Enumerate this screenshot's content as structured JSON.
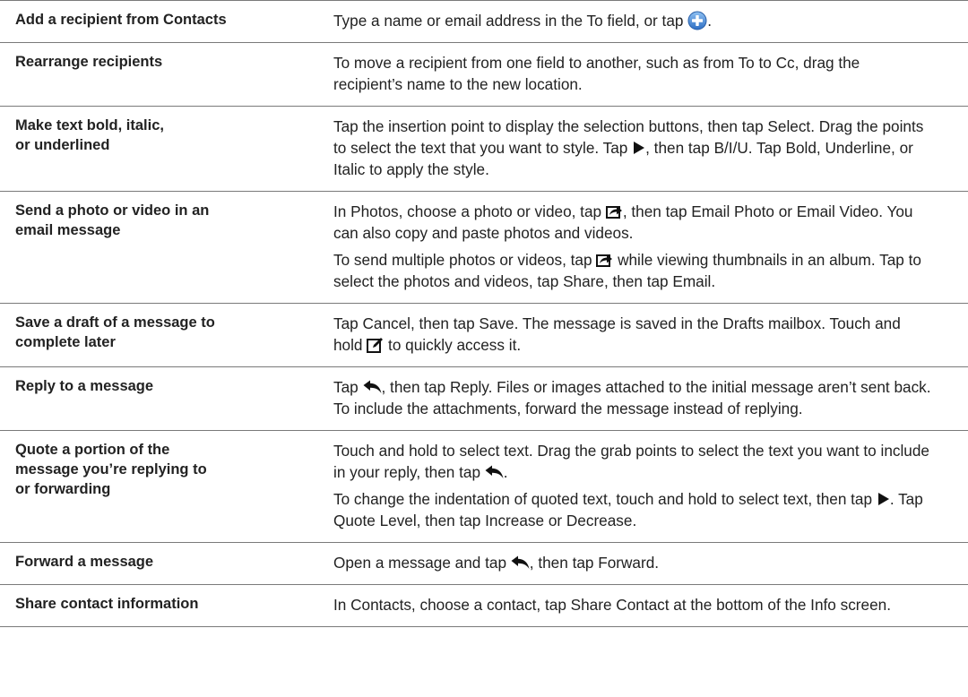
{
  "rows": [
    {
      "task": [
        "Add a recipient from Contacts"
      ],
      "paras": [
        [
          {
            "t": "Type a name or email address in the To field, or tap "
          },
          {
            "icon": "add-contact-icon"
          },
          {
            "t": "."
          }
        ]
      ]
    },
    {
      "task": [
        "Rearrange recipients"
      ],
      "paras": [
        [
          {
            "t": "To move a recipient from one field to another, such as from To to Cc, drag the recipient’s name to the new location."
          }
        ]
      ]
    },
    {
      "task": [
        "Make text bold, italic,",
        "or underlined"
      ],
      "paras": [
        [
          {
            "t": "Tap the insertion point to display the selection buttons, then tap Select. Drag the points to select the text that you want to style. Tap "
          },
          {
            "icon": "right-arrow-icon"
          },
          {
            "t": ", then tap B/I/U. Tap Bold, Underline, or Italic to apply the style."
          }
        ]
      ]
    },
    {
      "task": [
        "Send a photo or video in an",
        "email message"
      ],
      "paras": [
        [
          {
            "t": "In Photos, choose a photo or video, tap "
          },
          {
            "icon": "share-icon"
          },
          {
            "t": ", then tap Email Photo or Email Video. You can also copy and paste photos and videos."
          }
        ],
        [
          {
            "t": "To send multiple photos or videos, tap "
          },
          {
            "icon": "share-icon"
          },
          {
            "t": " while viewing thumbnails in an album. Tap to select the photos and videos, tap Share, then tap Email."
          }
        ]
      ]
    },
    {
      "task": [
        "Save a draft of a message to",
        "complete later"
      ],
      "paras": [
        [
          {
            "t": "Tap Cancel, then tap Save. The message is saved in the Drafts mailbox. Touch and hold "
          },
          {
            "icon": "compose-icon"
          },
          {
            "t": " to quickly access it."
          }
        ]
      ]
    },
    {
      "task": [
        "Reply to a message"
      ],
      "paras": [
        [
          {
            "t": "Tap "
          },
          {
            "icon": "reply-icon"
          },
          {
            "t": ", then tap Reply. Files or images attached to the initial message aren’t sent back. To include the attachments, forward the message instead of replying."
          }
        ]
      ]
    },
    {
      "task": [
        "Quote a portion of the",
        "message you’re replying to",
        "or forwarding"
      ],
      "paras": [
        [
          {
            "t": "Touch and hold to select text. Drag the grab points to select the text you want to include in your reply, then tap "
          },
          {
            "icon": "reply-icon"
          },
          {
            "t": "."
          }
        ],
        [
          {
            "t": "To change the indentation of quoted text, touch and hold to select text, then tap "
          },
          {
            "icon": "right-arrow-icon"
          },
          {
            "t": ". Tap Quote Level, then tap Increase or Decrease."
          }
        ]
      ]
    },
    {
      "task": [
        "Forward a message"
      ],
      "paras": [
        [
          {
            "t": "Open a message and tap "
          },
          {
            "icon": "reply-icon"
          },
          {
            "t": ", then tap Forward."
          }
        ]
      ]
    },
    {
      "task": [
        "Share contact information"
      ],
      "paras": [
        [
          {
            "t": "In Contacts, choose a contact, tap Share Contact at the bottom of the Info screen."
          }
        ]
      ]
    }
  ]
}
